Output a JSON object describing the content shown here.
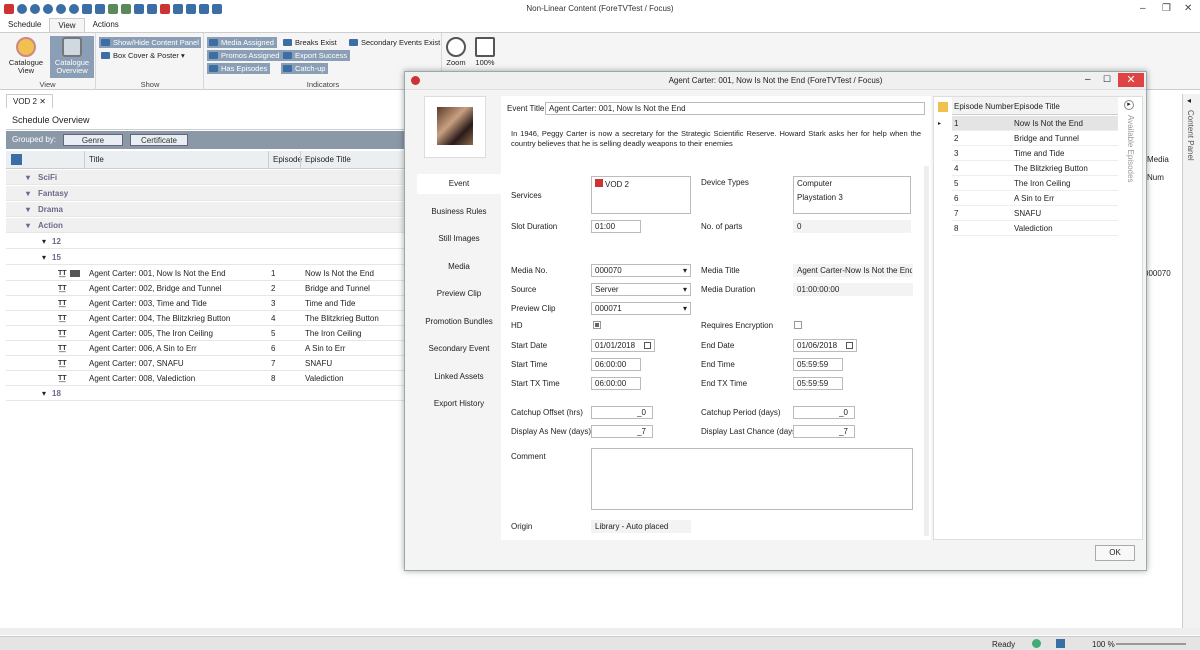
{
  "window": {
    "title": "Non-Linear Content (ForeTVTest / Focus)"
  },
  "ribbon": {
    "tabs": [
      "Schedule",
      "View",
      "Actions"
    ],
    "groups": {
      "view": "View",
      "show": "Show",
      "indicators": "Indicators"
    },
    "catalogue_view": "Catalogue View",
    "catalogue_overview": "Catalogue Overview",
    "show_hide_panel": "Show/Hide Content Panel",
    "box_cover": "Box Cover & Poster",
    "media_assigned": "Media Assigned",
    "breaks_exist": "Breaks Exist",
    "secondary_events_exist": "Secondary Events Exist",
    "promos_assigned": "Promos Assigned",
    "export_success": "Export Success",
    "has_episodes": "Has Episodes",
    "catch_up": "Catch-up",
    "zoom": "Zoom",
    "zoom_level": "100%"
  },
  "doc_tab": "VOD 2",
  "schedule": {
    "title": "Schedule Overview",
    "grouped_by": "Grouped by:",
    "group_chips": [
      "Genre",
      "Certificate"
    ],
    "columns": {
      "title": "Title",
      "episode": "Episode",
      "episode_title": "Episode Title",
      "media_num": "Media Num"
    },
    "genres": [
      "SciFi",
      "Fantasy",
      "Drama",
      "Action"
    ],
    "cert_groups": [
      "12",
      "15",
      "18"
    ],
    "rows": [
      {
        "title": "Agent Carter: 001, Now Is Not the End",
        "episode": "1",
        "episode_title": "Now Is Not the End",
        "media": "000070"
      },
      {
        "title": "Agent Carter: 002, Bridge and Tunnel",
        "episode": "2",
        "episode_title": "Bridge and Tunnel",
        "media": ""
      },
      {
        "title": "Agent Carter: 003, Time and Tide",
        "episode": "3",
        "episode_title": "Time and Tide",
        "media": ""
      },
      {
        "title": "Agent Carter: 004, The Blitzkrieg Button",
        "episode": "4",
        "episode_title": "The Blitzkrieg Button",
        "media": ""
      },
      {
        "title": "Agent Carter: 005, The Iron Ceiling",
        "episode": "5",
        "episode_title": "The Iron Ceiling",
        "media": ""
      },
      {
        "title": "Agent Carter: 006, A Sin to Err",
        "episode": "6",
        "episode_title": "A Sin to Err",
        "media": ""
      },
      {
        "title": "Agent Carter: 007, SNAFU",
        "episode": "7",
        "episode_title": "SNAFU",
        "media": ""
      },
      {
        "title": "Agent Carter: 008, Valediction",
        "episode": "8",
        "episode_title": "Valediction",
        "media": ""
      }
    ]
  },
  "dialog": {
    "title": "Agent Carter: 001, Now Is Not the End (ForeTVTest / Focus)",
    "nav": [
      "Event",
      "Business Rules",
      "Still Images",
      "Media",
      "Preview Clip",
      "Promotion Bundles",
      "Secondary Event",
      "Linked Assets",
      "Export History"
    ],
    "event_title_label": "Event Title",
    "event_title": "Agent Carter: 001, Now Is Not the End",
    "synopsis": "In 1946, Peggy Carter is now a secretary for the Strategic Scientific Reserve. Howard Stark asks her for help when the country believes that he is selling deadly weapons to their enemies",
    "services_label": "Services",
    "service": "VOD 2",
    "device_types_label": "Device Types",
    "device_types": [
      "Computer",
      "Playstation 3"
    ],
    "slot_duration_label": "Slot Duration",
    "slot_duration": "01:00",
    "parts_label": "No. of parts",
    "parts": "0",
    "media_no_label": "Media No.",
    "media_no": "000070",
    "media_title_label": "Media Title",
    "media_title": "Agent Carter-Now Is Not the End",
    "source_label": "Source",
    "source": "Server",
    "media_duration_label": "Media Duration",
    "media_duration": "01:00:00:00",
    "preview_clip_label": "Preview Clip",
    "preview_clip": "000071",
    "hd_label": "HD",
    "encryption_label": "Requires Encryption",
    "start_date_label": "Start Date",
    "start_date": "01/01/2018",
    "end_date_label": "End Date",
    "end_date": "01/06/2018",
    "start_time_label": "Start Time",
    "start_time": "06:00:00",
    "end_time_label": "End Time",
    "end_time": "05:59:59",
    "start_tx_label": "Start TX Time",
    "start_tx": "06:00:00",
    "end_tx_label": "End TX Time",
    "end_tx": "05:59:59",
    "catchup_offset_label": "Catchup Offset (hrs)",
    "catchup_offset": "_0",
    "catchup_period_label": "Catchup Period (days)",
    "catchup_period": "_0",
    "display_new_label": "Display As New (days)",
    "display_new": "_7",
    "display_last_label": "Display Last Chance (days)",
    "display_last": "_7",
    "comment_label": "Comment",
    "origin_label": "Origin",
    "origin": "Library - Auto placed",
    "ep_col_number": "Episode Number",
    "ep_col_title": "Episode Title",
    "episodes": [
      {
        "n": "1",
        "t": "Now Is Not the End"
      },
      {
        "n": "2",
        "t": "Bridge and Tunnel"
      },
      {
        "n": "3",
        "t": "Time and Tide"
      },
      {
        "n": "4",
        "t": "The Blitzkrieg Button"
      },
      {
        "n": "5",
        "t": "The Iron Ceiling"
      },
      {
        "n": "6",
        "t": "A Sin to Err"
      },
      {
        "n": "7",
        "t": "SNAFU"
      },
      {
        "n": "8",
        "t": "Valediction"
      }
    ],
    "available_episodes": "Available Episodes",
    "ok": "OK"
  },
  "content_panel": "Content Panel",
  "status": {
    "ready": "Ready",
    "zoom": "100 %"
  }
}
